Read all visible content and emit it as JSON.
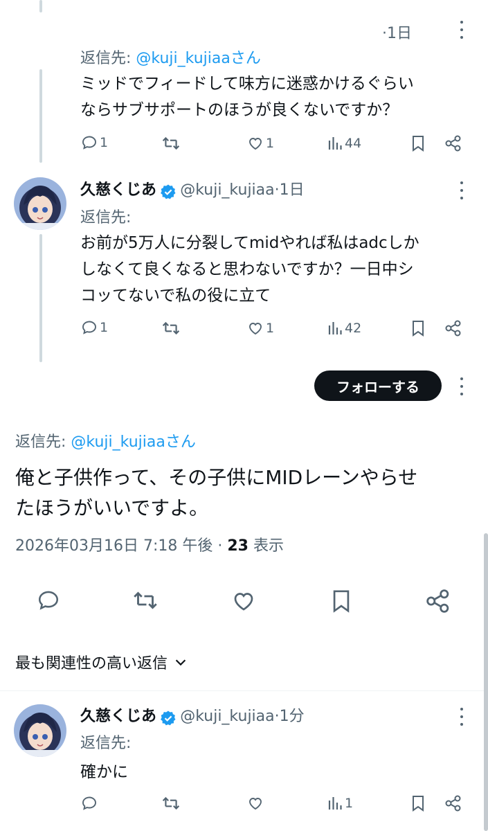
{
  "tweet1": {
    "time": "·1日",
    "reply_label": "返信先:",
    "reply_to": "@kuji_kujiaaさん",
    "text_line1": "ミッドでフィードして味方に迷惑かけるぐらい",
    "text_line2": "ならサブサポートのほうが良くないですか？",
    "reply_count": "1",
    "retweet_count": "",
    "like_count": "1",
    "view_count": "44"
  },
  "tweet2": {
    "name": "久慈くじあ",
    "handle": "@kuji_kujiaa",
    "time": "·1日",
    "reply_label": "返信先:",
    "text_line1": "お前が5万人に分裂してmidやれば私はadcしか",
    "text_line2": "しなくて良くなると思わないですか？一日中シ",
    "text_line3": "コッてないで私の役に立て",
    "reply_count": "1",
    "like_count": "1",
    "view_count": "42"
  },
  "follow_button": "フォローする",
  "main_tweet": {
    "reply_label": "返信先:",
    "reply_to": "@kuji_kujiaaさん",
    "text_line1": "俺と子供作って、その子供にMIDレーンやらせ",
    "text_line2": "たほうがいいですよ。",
    "timestamp": "2026年03月16日 7:18 午後 · ",
    "views_number": "23",
    "views_label": " 表示"
  },
  "sort_label": "最も関連性の高い返信",
  "reply1": {
    "name": "久慈くじあ",
    "handle": "@kuji_kujiaa",
    "time": "·1分",
    "reply_label": "返信先:",
    "text": "確かに",
    "view_count": "1"
  },
  "colors": {
    "accent": "#1d9bf0",
    "text": "#0f1419",
    "muted": "#536471",
    "thread_line": "#cfd9de"
  }
}
